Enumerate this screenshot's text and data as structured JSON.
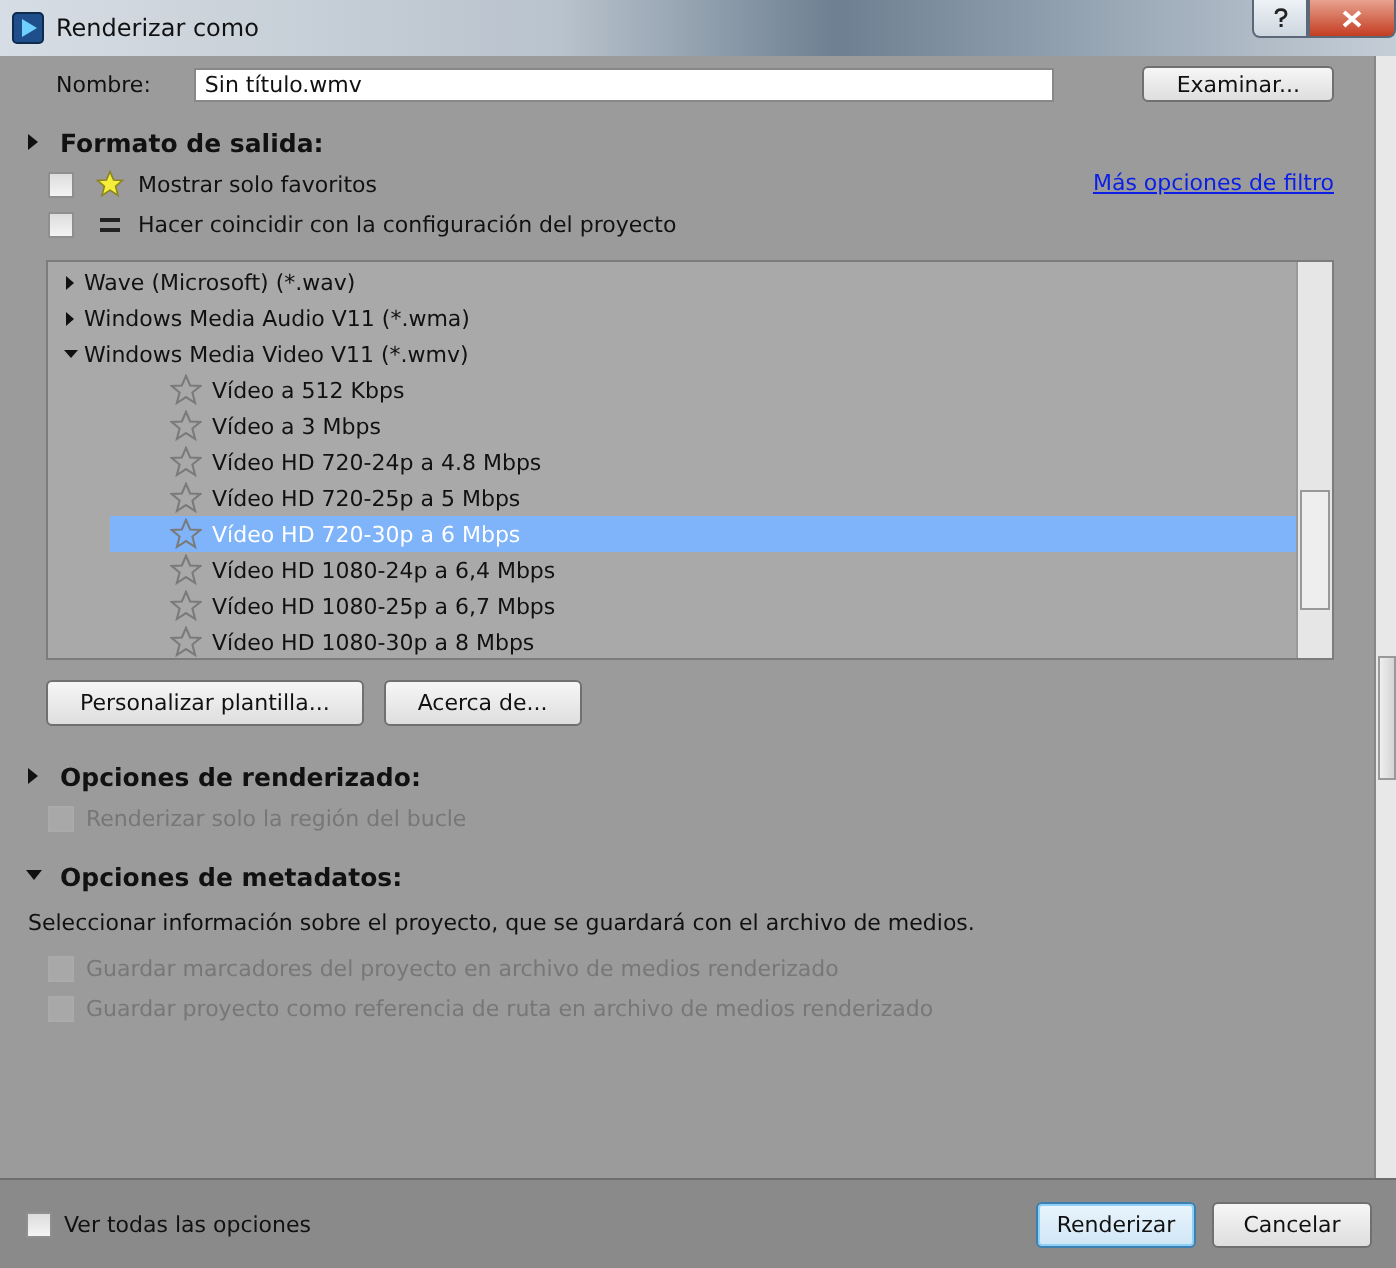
{
  "window": {
    "title": "Renderizar como"
  },
  "name_row": {
    "label": "Nombre:",
    "value": "Sin título.wmv",
    "browse_button": "Examinar..."
  },
  "output_format": {
    "title": "Formato de salida:",
    "expanded": false,
    "filters": [
      {
        "kind": "star",
        "label": "Mostrar solo favoritos",
        "checked": false
      },
      {
        "kind": "equals",
        "label": "Hacer coincidir con la configuración del proyecto",
        "checked": false
      }
    ],
    "filter_link": "Más opciones de filtro",
    "tree": [
      {
        "label": "Wave (Microsoft) (*.wav)",
        "expanded": false
      },
      {
        "label": "Windows Media Audio V11 (*.wma)",
        "expanded": false
      },
      {
        "label": "Windows Media Video V11 (*.wmv)",
        "expanded": true,
        "children": [
          {
            "label": "Vídeo a 512 Kbps",
            "selected": false
          },
          {
            "label": "Vídeo a 3 Mbps",
            "selected": false
          },
          {
            "label": "Vídeo HD 720-24p a 4.8 Mbps",
            "selected": false
          },
          {
            "label": "Vídeo HD 720-25p a 5 Mbps",
            "selected": false
          },
          {
            "label": "Vídeo HD 720-30p a 6 Mbps",
            "selected": true
          },
          {
            "label": "Vídeo HD 1080-24p a 6,4 Mbps",
            "selected": false
          },
          {
            "label": "Vídeo HD 1080-25p a 6,7 Mbps",
            "selected": false
          },
          {
            "label": "Vídeo HD 1080-30p a 8 Mbps",
            "selected": false
          }
        ]
      }
    ],
    "buttons": [
      "Personalizar plantilla...",
      "Acerca de..."
    ]
  },
  "render_options": {
    "title": "Opciones de renderizado:",
    "expanded": false,
    "options": [
      {
        "label": "Renderizar solo la región del bucle",
        "checked": false,
        "disabled": true
      }
    ]
  },
  "metadata_options": {
    "title": "Opciones de metadatos:",
    "expanded": true,
    "description": "Seleccionar información sobre el proyecto, que se guardará con el archivo de medios.",
    "options": [
      {
        "label": "Guardar marcadores del proyecto en archivo de medios renderizado",
        "checked": false,
        "disabled": true
      },
      {
        "label": "Guardar proyecto como referencia de ruta en archivo de medios renderizado",
        "checked": false,
        "disabled": true
      }
    ]
  },
  "footer": {
    "show_all": {
      "label": "Ver todas las opciones",
      "checked": false
    },
    "buttons": [
      {
        "label": "Renderizar",
        "default": true
      },
      {
        "label": "Cancelar",
        "default": false
      }
    ]
  }
}
